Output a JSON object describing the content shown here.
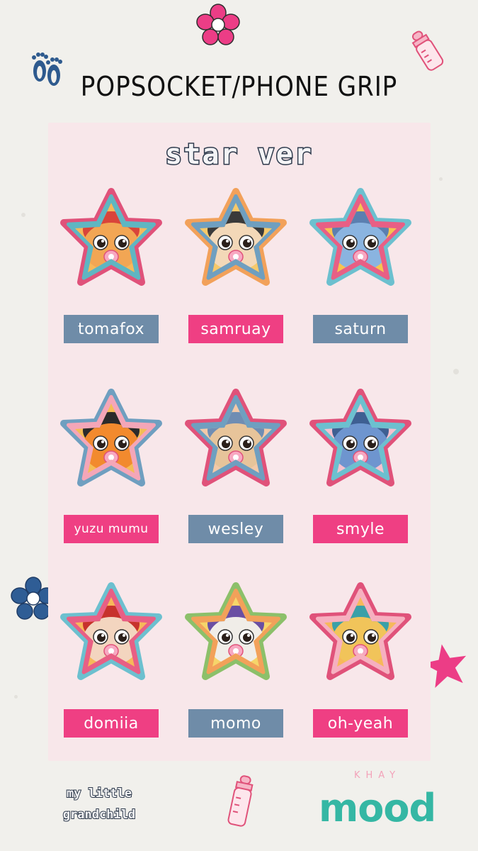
{
  "header": {
    "title": "POPSOCKET/PHONE GRIP",
    "subtitle": "star ver"
  },
  "characters": [
    {
      "name": "tomafox",
      "label_color": "blue",
      "frame": "#e0527a",
      "inner": "#5fb6c2",
      "sky": "#f7b85a",
      "face": "#f2a654",
      "hair": "#d9443a"
    },
    {
      "name": "samruay",
      "label_color": "pink",
      "frame": "#f2a15a",
      "inner": "#6f9fc0",
      "sky": "#f6c96a",
      "face": "#f3d8b8",
      "hair": "#3a3a3a"
    },
    {
      "name": "saturn",
      "label_color": "blue",
      "frame": "#6cc0cf",
      "inner": "#e85f85",
      "sky": "#f7c44f",
      "face": "#8ab4e0",
      "hair": "#5b7fb0"
    },
    {
      "name": "yuzu mumu",
      "label_color": "pink",
      "frame": "#6f9fc0",
      "inner": "#f4a6b8",
      "sky": "#f5bd55",
      "face": "#f28a2e",
      "hair": "#2b2b2b"
    },
    {
      "name": "wesley",
      "label_color": "blue",
      "frame": "#e0527a",
      "inner": "#6f9fc0",
      "sky": "#f3c9a8",
      "face": "#e7c49a",
      "hair": "#6f8db3"
    },
    {
      "name": "smyle",
      "label_color": "pink",
      "frame": "#e0527a",
      "inner": "#6cc0cf",
      "sky": "#f6c1cf",
      "face": "#6e95cf",
      "hair": "#3e5f92"
    },
    {
      "name": "domiia",
      "label_color": "pink",
      "frame": "#6cc0cf",
      "inner": "#e85f85",
      "sky": "#f7b85a",
      "face": "#f3d5bf",
      "hair": "#c7322c"
    },
    {
      "name": "momo",
      "label_color": "blue",
      "frame": "#8cc06a",
      "inner": "#f2a15a",
      "sky": "#f6d56a",
      "face": "#f0ede8",
      "hair": "#6a4fa3"
    },
    {
      "name": "oh-yeah",
      "label_color": "pink",
      "frame": "#e0527a",
      "inner": "#f6b0c0",
      "sky": "#f7b85a",
      "face": "#f1c45a",
      "hair": "#3aa0a8"
    }
  ],
  "footer": {
    "tagline_line1": "my little",
    "tagline_line2": "grandchild",
    "brand_top": "KHAY",
    "brand_main": "mood"
  },
  "colors": {
    "label_blue": "#6f8ca8",
    "label_pink": "#ef3f83",
    "panel": "#f8e7ea",
    "brand_teal": "#35b7a4",
    "brand_pink": "#f3a2b9"
  },
  "decorations": [
    "baby-footprints-icon",
    "pink-flower-icon",
    "baby-bottle-icon",
    "blue-flower-icon",
    "pink-star-icon",
    "baby-bottle-icon"
  ]
}
